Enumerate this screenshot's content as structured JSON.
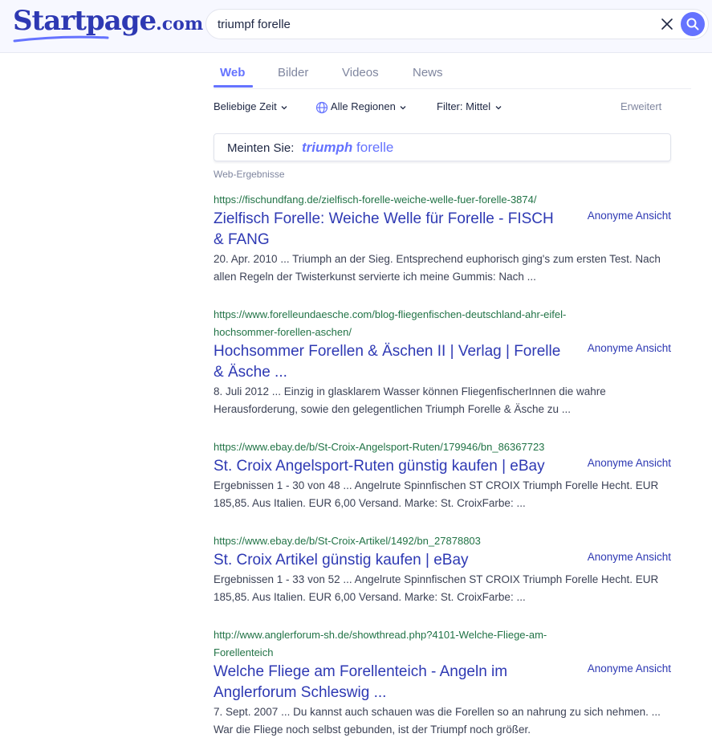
{
  "logo": {
    "main": "Startpage",
    "tld": ".com"
  },
  "search": {
    "query": "triumpf forelle"
  },
  "tabs": [
    {
      "label": "Web",
      "active": true
    },
    {
      "label": "Bilder",
      "active": false
    },
    {
      "label": "Videos",
      "active": false
    },
    {
      "label": "News",
      "active": false
    }
  ],
  "filters": {
    "time": "Beliebige Zeit",
    "region": "Alle Regionen",
    "safe": "Filter: Mittel",
    "advanced": "Erweitert"
  },
  "did_you_mean": {
    "prefix": "Meinten Sie:",
    "corrected": "triumph",
    "rest": "forelle"
  },
  "results_label": "Web-Ergebnisse",
  "anon_label": "Anonyme Ansicht",
  "results": [
    {
      "url": "https://fischundfang.de/zielfisch-forelle-weiche-welle-fuer-forelle-3874/",
      "title": "Zielfisch Forelle: Weiche Welle für Forelle - FISCH & FANG",
      "snippet": "20. Apr. 2010 ... Triumph an der Sieg. Entsprechend euphorisch ging's zum ersten Test. Nach allen Regeln der Twisterkunst servierte ich meine Gummis: Nach ..."
    },
    {
      "url": "https://www.forelleundaesche.com/blog-fliegenfischen-deutschland-ahr-eifel-hochsommer-forellen-aschen/",
      "title": "Hochsommer Forellen & Äschen II | Verlag | Forelle & Äsche ...",
      "snippet": "8. Juli 2012 ... Einzig in glasklarem Wasser können FliegenfischerInnen die wahre Herausforderung, sowie den gelegentlichen Triumph Forelle & Äsche zu ..."
    },
    {
      "url": "https://www.ebay.de/b/St-Croix-Angelsport-Ruten/179946/bn_86367723",
      "title": "St. Croix Angelsport-Ruten günstig kaufen | eBay",
      "snippet": "Ergebnissen 1 - 30 von 48 ... Angelrute Spinnfischen ST CROIX Triumph Forelle Hecht. EUR 185,85. Aus Italien. EUR 6,00 Versand. Marke: St. CroixFarbe: ..."
    },
    {
      "url": "https://www.ebay.de/b/St-Croix-Artikel/1492/bn_27878803",
      "title": "St. Croix Artikel günstig kaufen | eBay",
      "snippet": "Ergebnissen 1 - 33 von 52 ... Angelrute Spinnfischen ST CROIX Triumph Forelle Hecht. EUR 185,85. Aus Italien. EUR 6,00 Versand. Marke: St. CroixFarbe: ..."
    },
    {
      "url": "http://www.anglerforum-sh.de/showthread.php?4101-Welche-Fliege-am-Forellenteich",
      "title": "Welche Fliege am Forellenteich - Angeln im Anglerforum Schleswig ...",
      "snippet": "7. Sept. 2007 ... Du kannst auch schauen was die Forellen so an nahrung zu sich nehmen. ... War die Fliege noch selbst gebunden, ist der Triumpf noch größer."
    }
  ]
}
